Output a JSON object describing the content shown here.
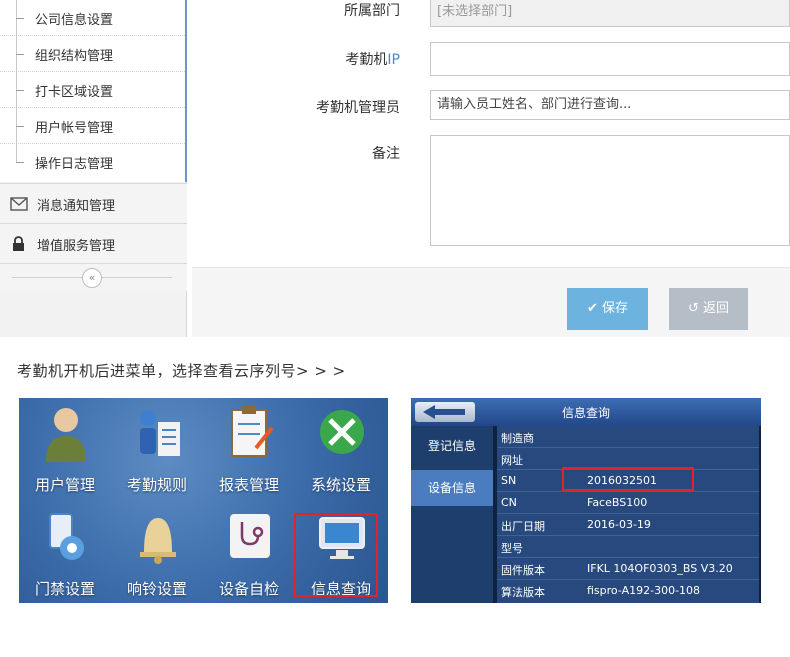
{
  "sidebar": {
    "sub_items": [
      {
        "label": "公司信息设置"
      },
      {
        "label": "组织结构管理"
      },
      {
        "label": "打卡区域设置"
      },
      {
        "label": "用户帐号管理"
      },
      {
        "label": "操作日志管理"
      }
    ],
    "main_items": [
      {
        "label": "消息通知管理",
        "icon": "envelope-icon"
      },
      {
        "label": "增值服务管理",
        "icon": "lock-icon"
      }
    ],
    "collapse_glyph": "«"
  },
  "form": {
    "department_label": "所属部门",
    "department_value": "[未选择部门]",
    "ip_label_prefix": "考勤机",
    "ip_label_suffix": "IP",
    "ip_value": "",
    "admin_label": "考勤机管理员",
    "admin_placeholder": "请输入员工姓名、部门进行查询...",
    "notes_label": "备注",
    "notes_value": "",
    "save_label": "保存",
    "back_label": "返回"
  },
  "instruction": "考勤机开机后进菜单，选择查看云序列号> > >",
  "device_menu": {
    "tiles": [
      {
        "label": "用户管理",
        "icon": "user-icon"
      },
      {
        "label": "考勤规则",
        "icon": "people-icon"
      },
      {
        "label": "报表管理",
        "icon": "clipboard-icon"
      },
      {
        "label": "系统设置",
        "icon": "tools-icon"
      },
      {
        "label": "门禁设置",
        "icon": "door-icon"
      },
      {
        "label": "响铃设置",
        "icon": "bell-icon"
      },
      {
        "label": "设备自检",
        "icon": "stethoscope-icon"
      },
      {
        "label": "信息查询",
        "icon": "monitor-icon"
      }
    ]
  },
  "device_info": {
    "title": "信息查询",
    "side_items": [
      {
        "label": "登记信息"
      },
      {
        "label": "设备信息"
      }
    ],
    "rows": [
      {
        "key": "制造商",
        "value": ""
      },
      {
        "key": "网址",
        "value": ""
      },
      {
        "key": "SN",
        "value": "2016032501"
      },
      {
        "key": "CN",
        "value": "FaceBS100"
      },
      {
        "key": "出厂日期",
        "value": "2016-03-19"
      },
      {
        "key": "型号",
        "value": ""
      },
      {
        "key": "固件版本",
        "value": "IFKL 104OF0303_BS V3.20"
      },
      {
        "key": "算法版本",
        "value": "fispro-A192-300-108"
      }
    ]
  },
  "colors": {
    "accent": "#6cb3e0",
    "highlight": "#e0242a",
    "sidebar_border": "#6a98c6"
  }
}
